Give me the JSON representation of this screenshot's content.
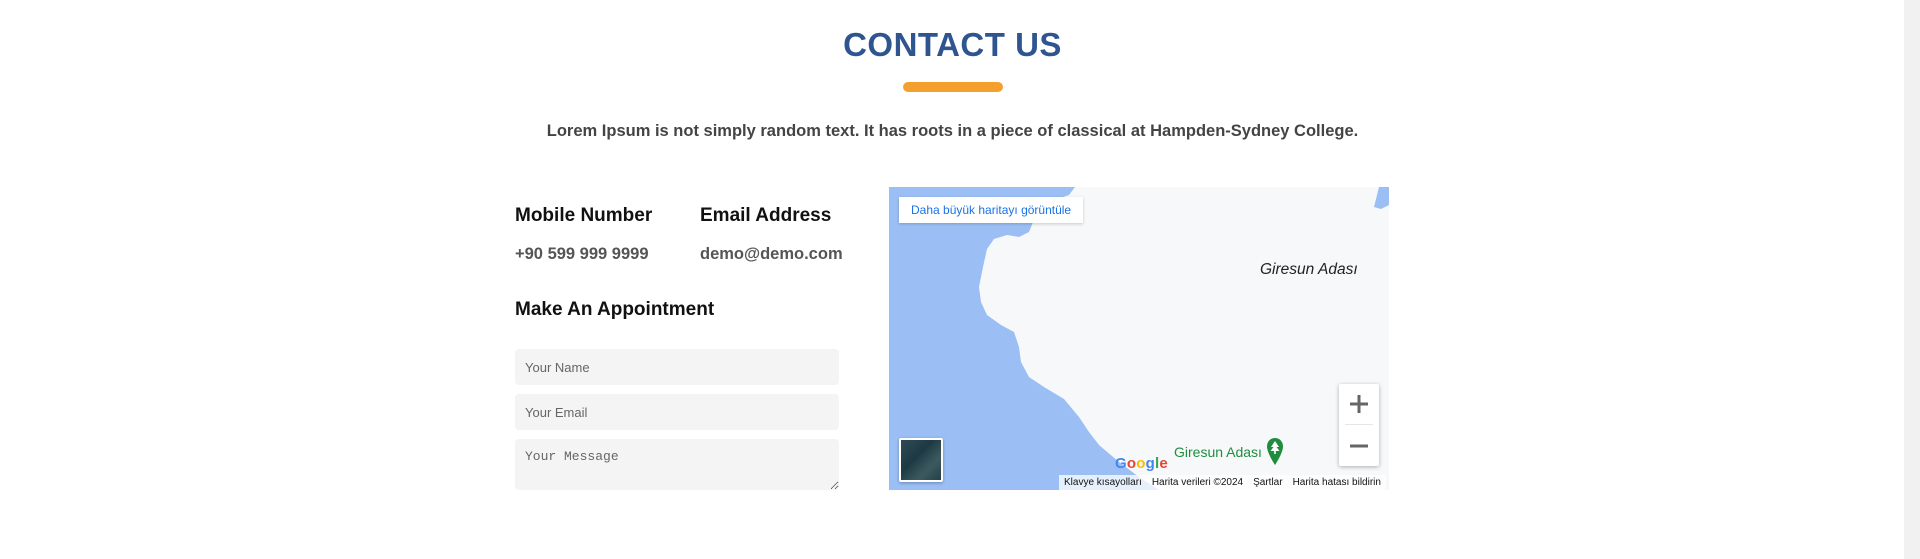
{
  "section": {
    "title": "CONTACT US",
    "subtitle": "Lorem Ipsum is not simply random text. It has roots in a piece of classical at Hampden-Sydney College."
  },
  "contact": {
    "mobile_heading": "Mobile Number",
    "mobile_value": "+90 599 999 9999",
    "email_heading": "Email Address",
    "email_value": "demo@demo.com"
  },
  "appointment": {
    "heading": "Make An Appointment",
    "name_placeholder": "Your Name",
    "email_placeholder": "Your Email",
    "message_placeholder": "Your Message"
  },
  "map": {
    "bigger_map_button": "Daha büyük haritayı görüntüle",
    "island_label": "Giresun Adası",
    "poi_label": "Giresun Adası",
    "google_logo": "Google",
    "attribution": {
      "shortcuts": "Klavye kısayolları",
      "map_data": "Harita verileri ©2024",
      "terms": "Şartlar",
      "report": "Harita hatası bildirin"
    },
    "zoom_in_icon": "plus-icon",
    "zoom_out_icon": "minus-icon"
  },
  "colors": {
    "title": "#2f5591",
    "accent": "#f4a02e",
    "water": "#9bbff4",
    "land": "#f7f8fa",
    "poi_green": "#1e8e3e"
  }
}
